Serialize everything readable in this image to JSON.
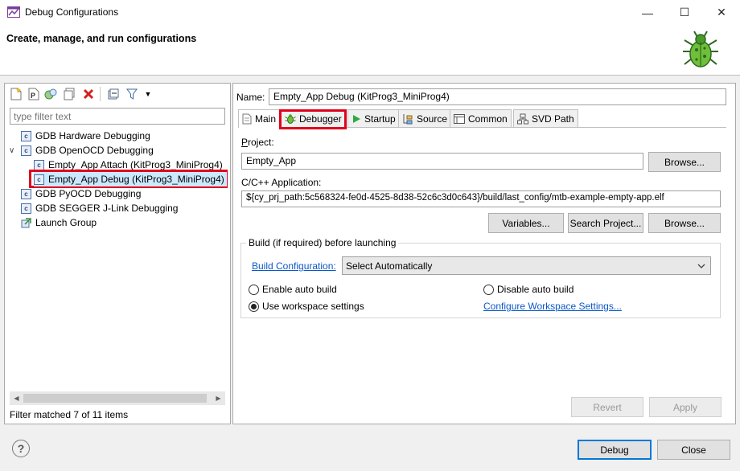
{
  "window": {
    "title": "Debug Configurations",
    "minimize_glyph": "—",
    "maximize_glyph": "☐",
    "close_glyph": "✕"
  },
  "header": {
    "title": "Create, manage, and run configurations",
    "icon": "bug-icon"
  },
  "left": {
    "filter_placeholder": "type filter text",
    "tree": [
      {
        "label": "GDB Hardware Debugging",
        "level": 0,
        "expanded": false
      },
      {
        "label": "GDB OpenOCD Debugging",
        "level": 0,
        "expanded": true
      },
      {
        "label": "Empty_App Attach (KitProg3_MiniProg4)",
        "level": 1
      },
      {
        "label": "Empty_App Debug (KitProg3_MiniProg4)",
        "level": 1,
        "selected": true
      },
      {
        "label": "GDB PyOCD Debugging",
        "level": 0
      },
      {
        "label": "GDB SEGGER J-Link Debugging",
        "level": 0
      },
      {
        "label": "Launch Group",
        "level": 0
      }
    ],
    "status": "Filter matched 7 of 11 items",
    "expand_glyph": "∨"
  },
  "right": {
    "name_label": "Name:",
    "name_value": "Empty_App Debug (KitProg3_MiniProg4)",
    "tabs": [
      {
        "label": "Main",
        "icon": "page-icon"
      },
      {
        "label": "Debugger",
        "icon": "bug-icon"
      },
      {
        "label": "Startup",
        "icon": "play-icon"
      },
      {
        "label": "Source",
        "icon": "source-icon"
      },
      {
        "label": "Common",
        "icon": "common-icon"
      },
      {
        "label": "SVD Path",
        "icon": "tree-icon"
      }
    ],
    "project_label": "Project:",
    "project_value": "Empty_App",
    "browse_label": "Browse...",
    "app_label": "C/C++ Application:",
    "app_value": "${cy_prj_path:5c568324-fe0d-4525-8d38-52c6c3d0c643}/build/last_config/mtb-example-empty-app.elf",
    "variables_label": "Variables...",
    "search_project_label": "Search Project...",
    "browse2_label": "Browse...",
    "build_group_label": "Build (if required) before launching",
    "build_config_link": "Build Configuration:",
    "build_config_value": "Select Automatically",
    "enable_auto_build": "Enable auto build",
    "disable_auto_build": "Disable auto build",
    "use_workspace": "Use workspace settings",
    "configure_workspace_link": "Configure Workspace Settings...",
    "revert_label": "Revert",
    "apply_label": "Apply"
  },
  "footer": {
    "help_glyph": "?",
    "debug_label": "Debug",
    "close_label": "Close"
  }
}
